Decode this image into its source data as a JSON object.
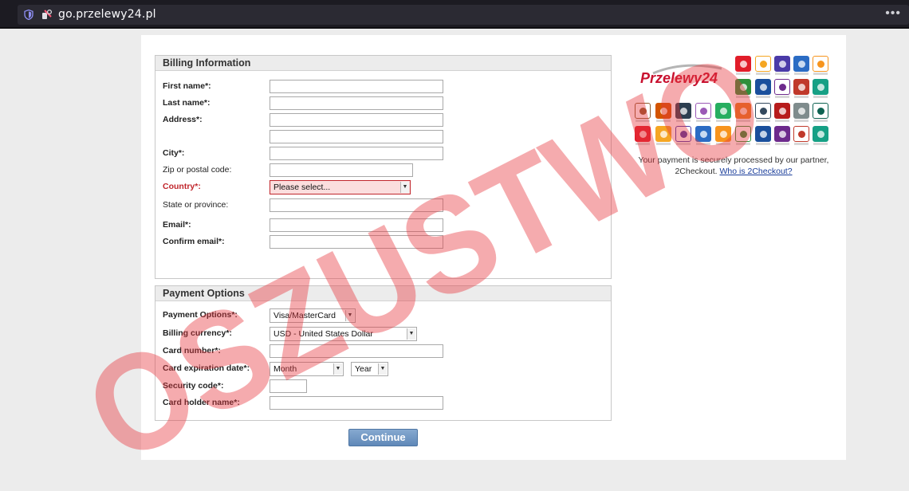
{
  "browser": {
    "url": "go.przelewy24.pl",
    "menu_icon": "ellipsis-icon"
  },
  "billing": {
    "title": "Billing Information",
    "fields": {
      "first_name": "First name*:",
      "last_name": "Last name*:",
      "address": "Address*:",
      "city": "City*:",
      "zip": "Zip or postal code:",
      "country": "Country*:",
      "state": "State or province:",
      "email": "Email*:",
      "confirm_email": "Confirm email*:"
    },
    "country_value": "Please select..."
  },
  "payment": {
    "title": "Payment Options",
    "fields": {
      "payment_options": "Payment Options*:",
      "billing_currency": "Billing currency*:",
      "card_number": "Card number*:",
      "expiration": "Card expiration date*:",
      "security_code": "Security code*:",
      "holder_name": "Card holder name*:"
    },
    "payment_option_value": "Visa/MasterCard",
    "currency_value": "USD - United States Dollar",
    "month_value": "Month",
    "year_value": "Year"
  },
  "continue_label": "Continue",
  "brand": {
    "logo_text": "Przelewy24",
    "secure_text": "Your payment is securely processed by our partner, 2Checkout.",
    "secure_link": "Who is 2Checkout?"
  },
  "watermark": {
    "text": "OSZUSTWO",
    "color": "#e8383d"
  },
  "colors": {
    "error_red": "#c1272d",
    "button_blue": "#5f88b8",
    "brand_red": "#c8102e"
  }
}
